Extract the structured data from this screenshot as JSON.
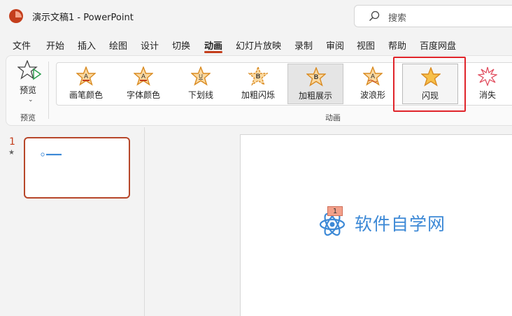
{
  "window": {
    "title": "演示文稿1  -  PowerPoint"
  },
  "search": {
    "placeholder": "搜索"
  },
  "tabs": [
    {
      "label": "文件"
    },
    {
      "label": "开始"
    },
    {
      "label": "插入"
    },
    {
      "label": "绘图"
    },
    {
      "label": "设计"
    },
    {
      "label": "切换"
    },
    {
      "label": "动画"
    },
    {
      "label": "幻灯片放映"
    },
    {
      "label": "录制"
    },
    {
      "label": "审阅"
    },
    {
      "label": "视图"
    },
    {
      "label": "帮助"
    },
    {
      "label": "百度网盘"
    }
  ],
  "ribbon": {
    "preview_label": "预览",
    "preview_group": "预览",
    "animation_group": "动画",
    "effects": [
      {
        "label": "画笔颜色",
        "letter": "A"
      },
      {
        "label": "字体颜色",
        "letter": "A"
      },
      {
        "label": "下划线",
        "letter": "U"
      },
      {
        "label": "加粗闪烁",
        "letter": "B"
      },
      {
        "label": "加粗展示",
        "letter": "B"
      },
      {
        "label": "波浪形",
        "letter": "A"
      },
      {
        "label": "闪现",
        "letter": ""
      },
      {
        "label": "消失",
        "letter": ""
      }
    ],
    "selected_effect": "加粗展示",
    "highlighted_effect": "闪现"
  },
  "slides": {
    "number": "1",
    "animation_marker": "★"
  },
  "slide": {
    "badge": "1",
    "logo_text": "软件自学网"
  },
  "colors": {
    "accent": "#c43e1c",
    "highlight": "#e0242a",
    "logo": "#3d89d6"
  }
}
